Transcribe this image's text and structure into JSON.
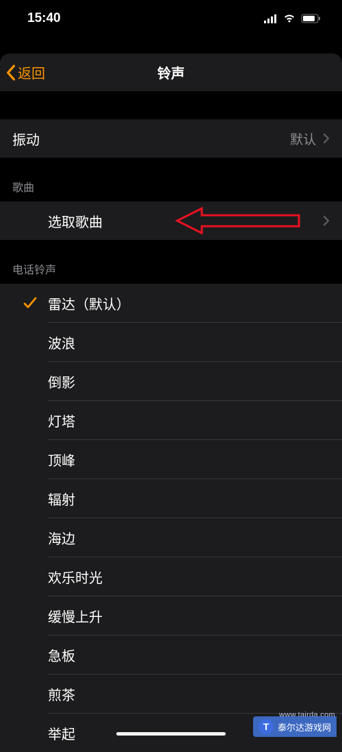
{
  "status": {
    "time": "15:40"
  },
  "nav": {
    "back": "返回",
    "title": "铃声"
  },
  "vibration": {
    "label": "振动",
    "value": "默认"
  },
  "songs": {
    "header": "歌曲",
    "pick": "选取歌曲"
  },
  "ringtones": {
    "header": "电话铃声",
    "items": [
      {
        "label": "雷达（默认）",
        "checked": true
      },
      {
        "label": "波浪",
        "checked": false
      },
      {
        "label": "倒影",
        "checked": false
      },
      {
        "label": "灯塔",
        "checked": false
      },
      {
        "label": "顶峰",
        "checked": false
      },
      {
        "label": "辐射",
        "checked": false
      },
      {
        "label": "海边",
        "checked": false
      },
      {
        "label": "欢乐时光",
        "checked": false
      },
      {
        "label": "缓慢上升",
        "checked": false
      },
      {
        "label": "急板",
        "checked": false
      },
      {
        "label": "煎茶",
        "checked": false
      },
      {
        "label": "举起",
        "checked": false
      }
    ]
  },
  "watermark": {
    "text": "泰尔达游戏网",
    "url": "www.tairda.com"
  }
}
